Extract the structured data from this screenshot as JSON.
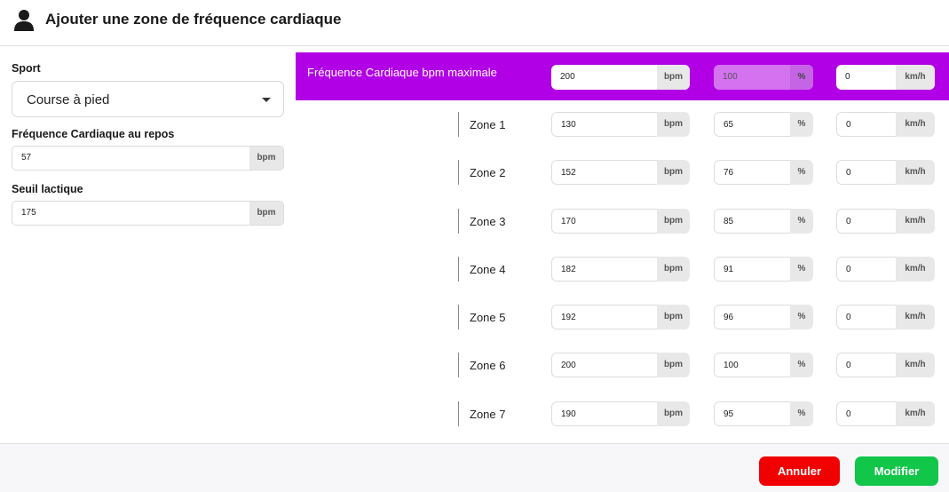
{
  "header": {
    "title": "Ajouter une zone de fréquence cardiaque",
    "icon": "user-icon"
  },
  "left": {
    "sport_label": "Sport",
    "sport_value": "Course à pied",
    "resting_label": "Fréquence Cardiaque au repos",
    "resting_value": "57",
    "resting_unit": "bpm",
    "lactate_label": "Seuil lactique",
    "lactate_value": "175",
    "lactate_unit": "bpm"
  },
  "max": {
    "label": "Fréquence Cardiaque bpm maximale",
    "bpm": "200",
    "bpm_unit": "bpm",
    "pct": "100",
    "pct_unit": "%",
    "speed": "0",
    "speed_unit": "km/h",
    "accent_color": "#b200e6"
  },
  "zones": [
    {
      "label": "Zone 1",
      "bpm": "130",
      "bpm_unit": "bpm",
      "pct": "65",
      "pct_unit": "%",
      "speed": "0",
      "speed_unit": "km/h"
    },
    {
      "label": "Zone 2",
      "bpm": "152",
      "bpm_unit": "bpm",
      "pct": "76",
      "pct_unit": "%",
      "speed": "0",
      "speed_unit": "km/h"
    },
    {
      "label": "Zone 3",
      "bpm": "170",
      "bpm_unit": "bpm",
      "pct": "85",
      "pct_unit": "%",
      "speed": "0",
      "speed_unit": "km/h"
    },
    {
      "label": "Zone 4",
      "bpm": "182",
      "bpm_unit": "bpm",
      "pct": "91",
      "pct_unit": "%",
      "speed": "0",
      "speed_unit": "km/h"
    },
    {
      "label": "Zone 5",
      "bpm": "192",
      "bpm_unit": "bpm",
      "pct": "96",
      "pct_unit": "%",
      "speed": "0",
      "speed_unit": "km/h"
    },
    {
      "label": "Zone 6",
      "bpm": "200",
      "bpm_unit": "bpm",
      "pct": "100",
      "pct_unit": "%",
      "speed": "0",
      "speed_unit": "km/h"
    },
    {
      "label": "Zone 7",
      "bpm": "190",
      "bpm_unit": "bpm",
      "pct": "95",
      "pct_unit": "%",
      "speed": "0",
      "speed_unit": "km/h"
    }
  ],
  "footer": {
    "cancel_label": "Annuler",
    "cancel_color": "#f00000",
    "modify_label": "Modifier",
    "modify_color": "#12c64a"
  }
}
